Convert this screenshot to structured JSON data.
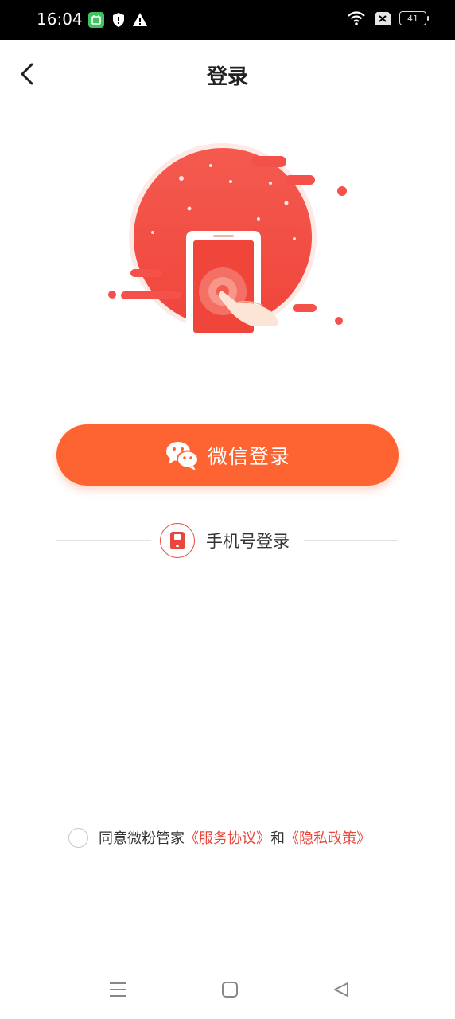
{
  "status_bar": {
    "time": "16:04",
    "battery": "41",
    "icons": [
      "app-notification-icon",
      "shield-icon",
      "warning-icon",
      "wifi-icon",
      "no-sim-icon",
      "battery-icon"
    ]
  },
  "header": {
    "title": "登录",
    "back_icon": "chevron-left-icon"
  },
  "main": {
    "illustration": "phone-tap-illustration",
    "wechat_login_label": "微信登录",
    "wechat_icon": "wechat-icon",
    "phone_login_label": "手机号登录",
    "phone_icon": "phone-icon"
  },
  "agreement": {
    "prefix": "同意微粉管家",
    "service_link": "《服务协议》",
    "joiner": "和",
    "privacy_link": "《隐私政策》"
  },
  "nav_bar": {
    "icons": [
      "menu-icon",
      "home-icon",
      "back-triangle-icon"
    ]
  },
  "colors": {
    "accent": "#fd6431",
    "link": "#e9473c",
    "illustration_red": "#f4514a"
  }
}
